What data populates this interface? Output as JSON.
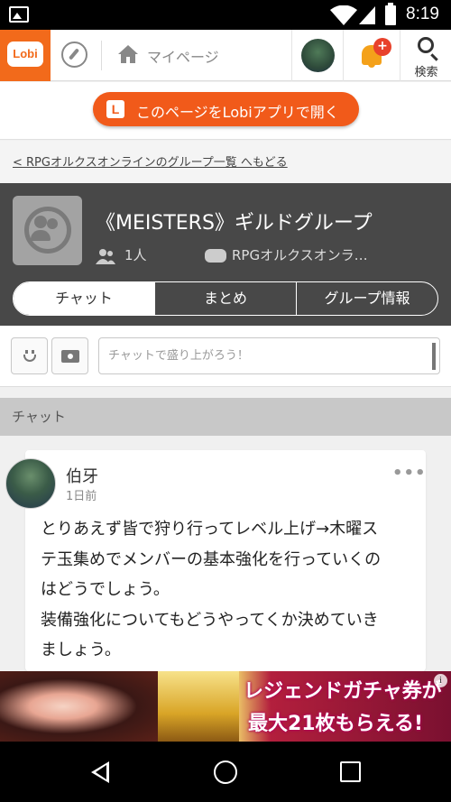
{
  "status_bar": {
    "time": "8:19"
  },
  "header": {
    "logo_text": "Lobi",
    "mypage_label": "マイページ",
    "notification_badge": "+",
    "search_label": "検索",
    "accent_color": "#f26a1b"
  },
  "open_app": {
    "logo_letter": "L",
    "label": "このページをLobiアプリで開く"
  },
  "back_link": {
    "label": "< RPGオルクスオンラインのグループ一覧 へもどる"
  },
  "group": {
    "title": "《MEISTERS》ギルドグループ",
    "members": "1人",
    "game": "RPGオルクスオンラ…",
    "tabs": [
      {
        "label": "チャット",
        "active": true
      },
      {
        "label": "まとめ",
        "active": false
      },
      {
        "label": "グループ情報",
        "active": false
      }
    ]
  },
  "composer": {
    "placeholder": "チャットで盛り上がろう！"
  },
  "chat": {
    "section_label": "チャット",
    "posts": [
      {
        "author": "伯牙",
        "time": "1日前",
        "menu": "•••",
        "lines": [
          "とりあえず皆で狩り行ってレベル上げ→木曜ス",
          "テ玉集めでメンバーの基本強化を行っていくの",
          "はどうでしょう。",
          "装備強化についてもどうやってくか決めていき",
          "ましょう。"
        ]
      }
    ]
  },
  "ad": {
    "line1": "レジェンドガチャ券が",
    "line2": "最大21枚もらえる!",
    "info": "i"
  }
}
